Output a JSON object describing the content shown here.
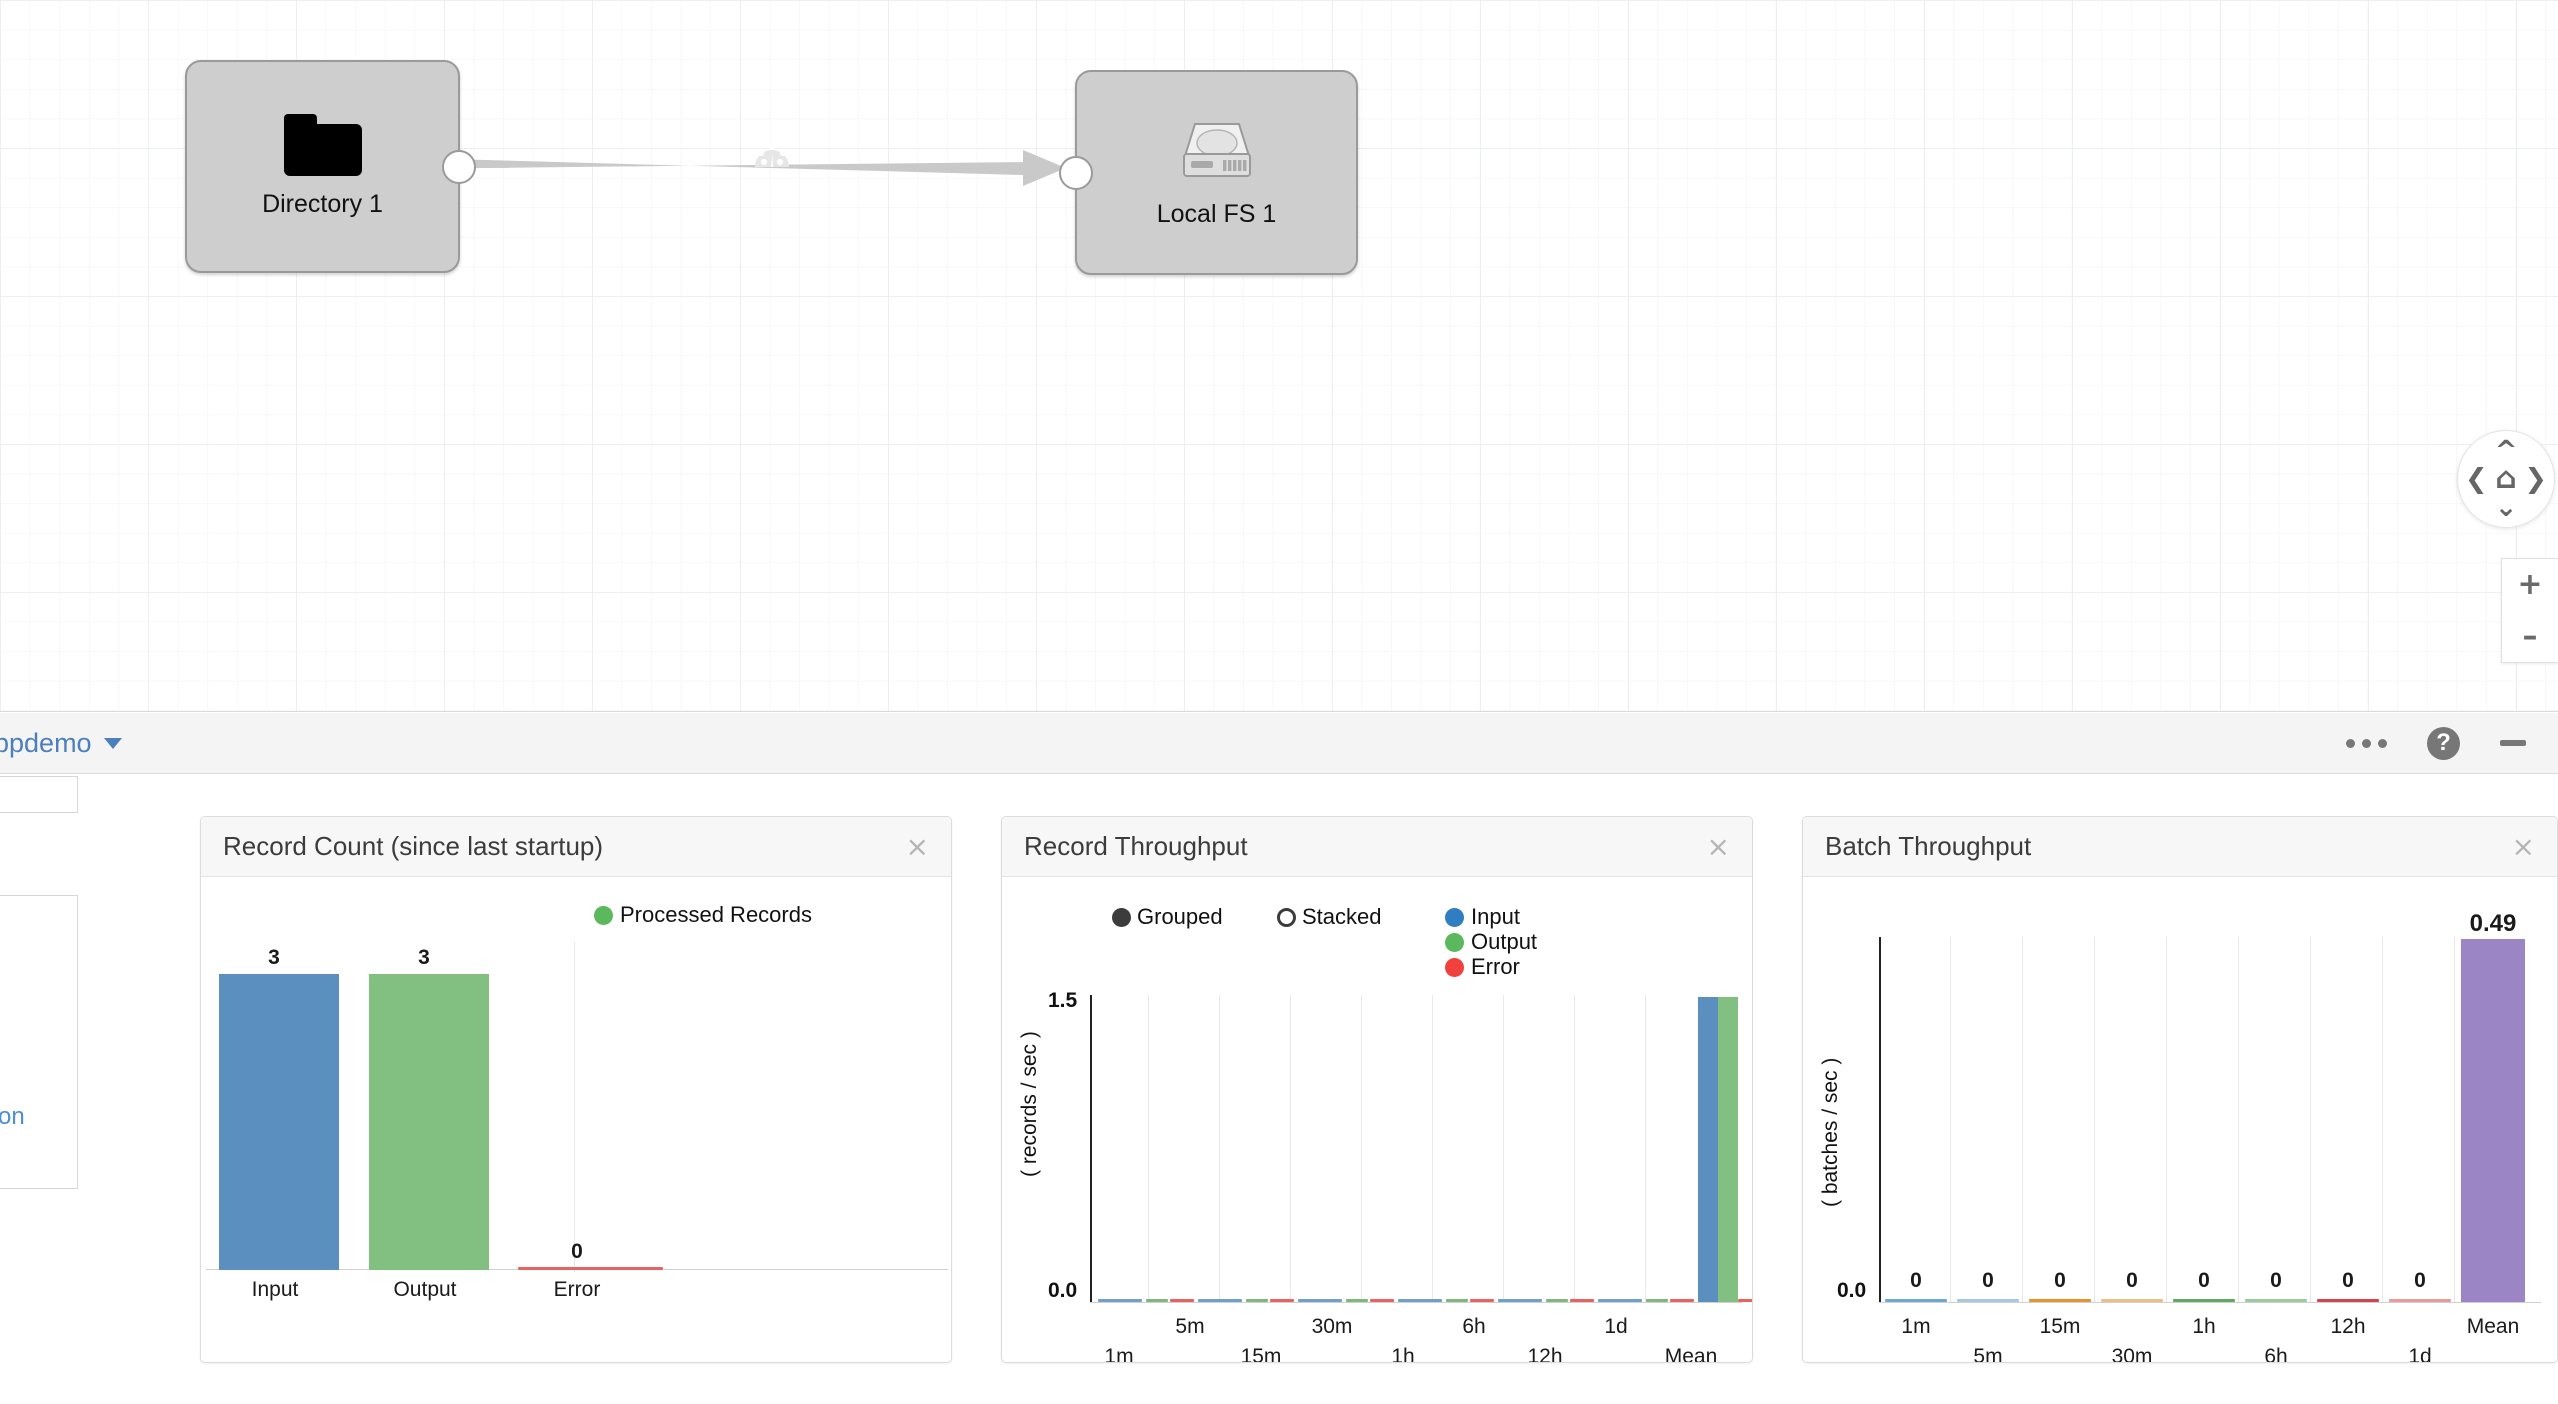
{
  "canvas": {
    "nodes": [
      {
        "label": "Directory 1",
        "icon": "folder-icon"
      },
      {
        "label": "Local FS 1",
        "icon": "hard-drive-icon"
      }
    ],
    "link": {
      "badge_icon": "gauge-icon"
    },
    "nav": {
      "up_icon": "chevron-up-icon",
      "down_icon": "chevron-down-icon",
      "left_icon": "chevron-left-icon",
      "right_icon": "chevron-right-icon",
      "home_icon": "home-icon",
      "zoom_in_label": "+",
      "zoom_out_label": "–"
    }
  },
  "toolbar": {
    "pipeline_name": "ppdemo",
    "dropdown_icon": "caret-down-icon",
    "more_icon": "ellipsis-icon",
    "help_icon": "help-circle-icon",
    "help_glyph": "?",
    "minimize_icon": "minimize-icon"
  },
  "sidebar_partial": {
    "link_text": "on"
  },
  "panels": [
    {
      "title": "Record Count (since last startup)",
      "close_label": "×"
    },
    {
      "title": "Record Throughput",
      "close_label": "×"
    },
    {
      "title": "Batch Throughput",
      "close_label": "×"
    }
  ],
  "chart_data": [
    {
      "type": "bar",
      "title": "Record Count (since last startup)",
      "xlabel": "",
      "ylabel": "",
      "categories": [
        "Input",
        "Output",
        "Error"
      ],
      "values": [
        3,
        3,
        0
      ],
      "data_labels": [
        "3",
        "3",
        "0"
      ],
      "colors": [
        "#5b8fc0",
        "#82c082",
        "#e8625f"
      ],
      "legend": [
        {
          "label": "Processed Records",
          "color": "#5cb85c"
        }
      ],
      "legend_position": "top-right",
      "grid": false,
      "ylim": [
        0,
        3.35
      ]
    },
    {
      "type": "bar",
      "title": "Record Throughput",
      "xlabel": "",
      "ylabel": "( records / sec )",
      "categories": [
        "1m",
        "5m",
        "15m",
        "30m",
        "1h",
        "6h",
        "12h",
        "1d",
        "Mean"
      ],
      "series": [
        {
          "name": "Input",
          "color": "#2f7ec1",
          "values": [
            0,
            0,
            0,
            0,
            0,
            0,
            0,
            0,
            1.5
          ]
        },
        {
          "name": "Output",
          "color": "#5cb85c",
          "values": [
            0,
            0,
            0,
            0,
            0,
            0,
            0,
            0,
            1.5
          ]
        },
        {
          "name": "Error",
          "color": "#f0413c",
          "values": [
            0,
            0,
            0,
            0,
            0,
            0,
            0,
            0,
            0
          ]
        }
      ],
      "ytick_labels": [
        "0.0",
        "1.5"
      ],
      "ylim": [
        0,
        1.5
      ],
      "grid": true,
      "legend_position": "top-right",
      "mode_options": [
        {
          "label": "Grouped",
          "selected": true
        },
        {
          "label": "Stacked",
          "selected": false
        }
      ]
    },
    {
      "type": "bar",
      "title": "Batch Throughput",
      "xlabel": "",
      "ylabel": "( batches / sec )",
      "categories": [
        "1m",
        "5m",
        "15m",
        "30m",
        "1h",
        "6h",
        "12h",
        "1d",
        "Mean"
      ],
      "values": [
        0,
        0,
        0,
        0,
        0,
        0,
        0,
        0,
        0.49
      ],
      "data_labels": [
        "0",
        "0",
        "0",
        "0",
        "0",
        "0",
        "0",
        "0",
        "0.49"
      ],
      "bar_colors": [
        "#6fa8d0",
        "#a8c8dd",
        "#e8912f",
        "#edbf86",
        "#62a862",
        "#9ecb9e",
        "#d1454f",
        "#e79b9b",
        "#9b85c4"
      ],
      "ytick_labels": [
        "0.0"
      ],
      "ylim": [
        0,
        0.56
      ],
      "grid": true
    }
  ]
}
